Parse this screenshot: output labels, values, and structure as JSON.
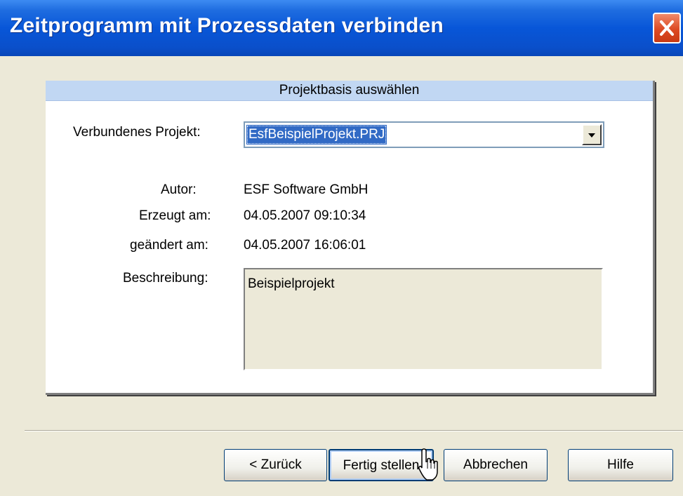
{
  "window": {
    "title": "Zeitprogramm mit Prozessdaten verbinden",
    "close_icon": "close-icon"
  },
  "panel": {
    "header": "Projektbasis auswählen",
    "project_label": "Verbundenes Projekt:",
    "project_value": "EsfBeispielProjekt.PRJ",
    "author_label": "Autor:",
    "author_value": "ESF Software GmbH",
    "created_label": "Erzeugt am:",
    "created_value": "04.05.2007 09:10:34",
    "changed_label": "geändert am:",
    "changed_value": "04.05.2007 16:06:01",
    "description_label": "Beschreibung:",
    "description_value": "Beispielprojekt"
  },
  "buttons": {
    "back": "< Zurück",
    "finish": "Fertig stellen",
    "cancel": "Abbrechen",
    "help": "Hilfe"
  },
  "colors": {
    "titlebar": "#0856d8",
    "panel_header": "#c1d7f3",
    "selection": "#316ac5",
    "close_button": "#dd4a23"
  }
}
